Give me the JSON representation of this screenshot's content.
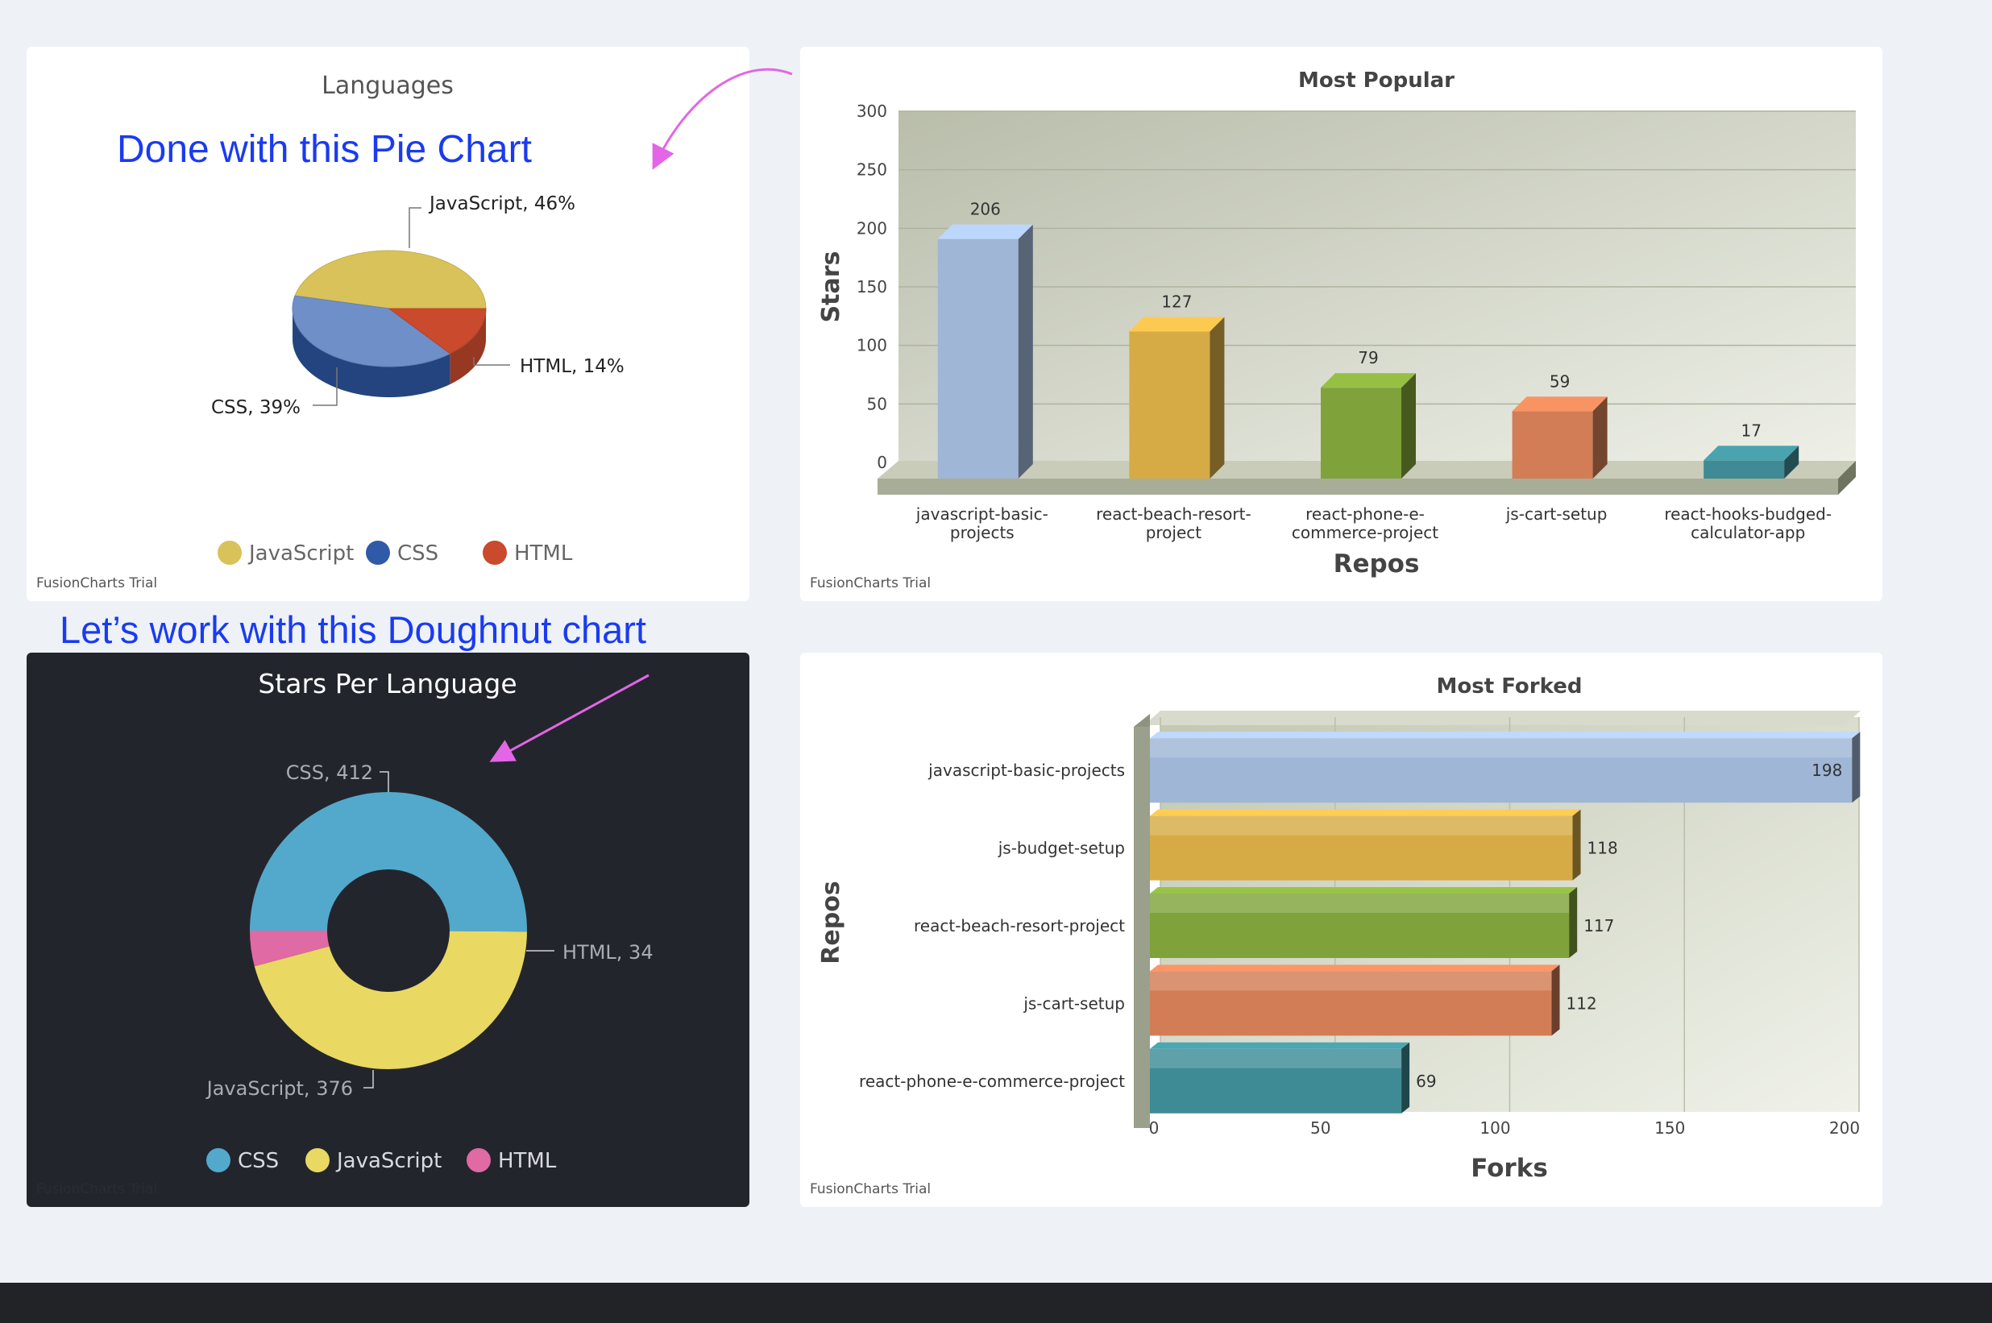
{
  "annotations": {
    "pie_note": "Done with this Pie Chart",
    "doughnut_note": "Let’s work with this Doughnut chart"
  },
  "watermark": "FusionCharts Trial",
  "chart_data": [
    {
      "id": "languages",
      "type": "pie",
      "title": "Languages",
      "categories": [
        "JavaScript",
        "CSS",
        "HTML"
      ],
      "values": [
        46,
        39,
        14
      ],
      "labels": [
        "JavaScript, 46%",
        "CSS, 39%",
        "HTML, 14%"
      ],
      "colors": [
        "#d9c25a",
        "#2f5aa8",
        "#c94a2d"
      ],
      "legend": [
        "JavaScript",
        "CSS",
        "HTML"
      ],
      "legend_position": "bottom"
    },
    {
      "id": "stars_per_language",
      "type": "pie",
      "subtype": "doughnut",
      "title": "Stars Per Language",
      "categories": [
        "CSS",
        "JavaScript",
        "HTML"
      ],
      "values": [
        412,
        376,
        34
      ],
      "labels": [
        "CSS, 412",
        "JavaScript, 376",
        "HTML, 34"
      ],
      "colors": [
        "#52a9cc",
        "#e9d862",
        "#e06aa3"
      ],
      "legend": [
        "CSS",
        "JavaScript",
        "HTML"
      ],
      "legend_position": "bottom"
    },
    {
      "id": "most_popular",
      "type": "bar",
      "orientation": "vertical",
      "title": "Most Popular",
      "xlabel": "Repos",
      "ylabel": "Stars",
      "categories": [
        [
          "javascript-basic-",
          "projects"
        ],
        [
          "react-beach-resort-",
          "project"
        ],
        [
          "react-phone-e-",
          "commerce-project"
        ],
        [
          "js-cart-setup"
        ],
        [
          "react-hooks-budged-",
          "calculator-app"
        ]
      ],
      "values": [
        206,
        127,
        79,
        59,
        17
      ],
      "value_labels": [
        "206",
        "127",
        "79",
        "59",
        "17"
      ],
      "yticks": [
        "0",
        "50",
        "100",
        "150",
        "200",
        "250",
        "300"
      ],
      "ylim": [
        0,
        300
      ],
      "grid": true
    },
    {
      "id": "most_forked",
      "type": "bar",
      "orientation": "horizontal",
      "title": "Most Forked",
      "xlabel": "Forks",
      "ylabel": "Repos",
      "categories": [
        "javascript-basic-projects",
        "js-budget-setup",
        "react-beach-resort-project",
        "js-cart-setup",
        "react-phone-e-commerce-project"
      ],
      "values": [
        198,
        118,
        117,
        112,
        69
      ],
      "value_labels": [
        "198",
        "118",
        "117",
        "112",
        "69"
      ],
      "xticks": [
        "0",
        "50",
        "100",
        "150",
        "200"
      ],
      "xlim": [
        0,
        200
      ],
      "grid": true
    }
  ]
}
